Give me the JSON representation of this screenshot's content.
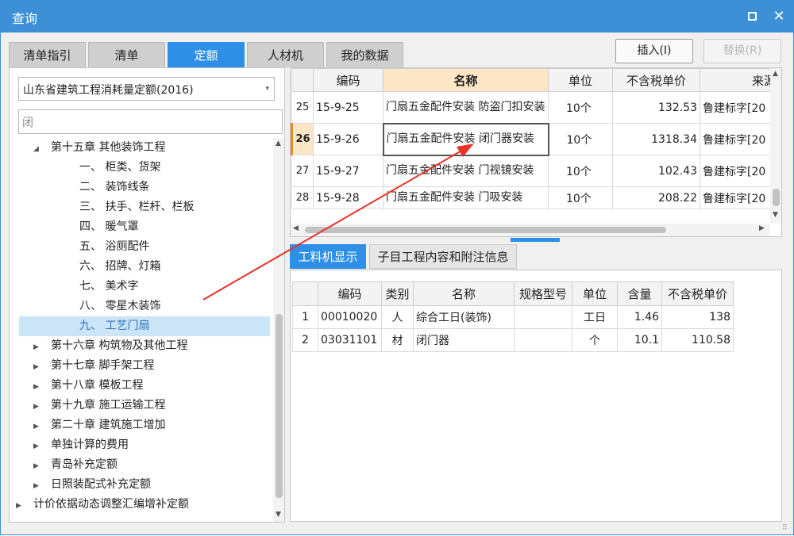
{
  "window": {
    "title": "查询",
    "maximize_glyph": "",
    "close_glyph": "✕"
  },
  "tabs": [
    "清单指引",
    "清单",
    "定额",
    "人材机",
    "我的数据"
  ],
  "active_tab": "定额",
  "buttons": {
    "insert": "插入(I)",
    "replace": "替换(R)"
  },
  "left": {
    "dropdown_value": "山东省建筑工程消耗量定额(2016)",
    "search_value": "闭",
    "tree": [
      {
        "label": "第十五章 其他装饰工程",
        "level": 1,
        "expanded": true
      },
      {
        "label": "一、 柜类、货架",
        "level": 2
      },
      {
        "label": "二、 装饰线条",
        "level": 2
      },
      {
        "label": "三、 扶手、栏杆、栏板",
        "level": 2
      },
      {
        "label": "四、 暖气罩",
        "level": 2
      },
      {
        "label": "五、 浴厕配件",
        "level": 2
      },
      {
        "label": "六、 招牌、灯箱",
        "level": 2
      },
      {
        "label": "七、 美术字",
        "level": 2
      },
      {
        "label": "八、 零星木装饰",
        "level": 2
      },
      {
        "label": "九、 工艺门扇",
        "level": 2,
        "selected": true
      },
      {
        "label": "第十六章 构筑物及其他工程",
        "level": 1
      },
      {
        "label": "第十七章 脚手架工程",
        "level": 1
      },
      {
        "label": "第十八章 模板工程",
        "level": 1
      },
      {
        "label": "第十九章 施工运输工程",
        "level": 1
      },
      {
        "label": "第二十章 建筑施工增加",
        "level": 1
      },
      {
        "label": "单独计算的费用",
        "level": 1
      },
      {
        "label": "青岛补充定额",
        "level": 1
      },
      {
        "label": "日照装配式补充定额",
        "level": 1
      },
      {
        "label": "计价依据动态调整汇编增补定额",
        "level": 0
      }
    ]
  },
  "quota_table": {
    "headers": [
      "编码",
      "名称",
      "单位",
      "不含税单价",
      "来源"
    ],
    "rows": [
      {
        "rn": "25",
        "code": "15-9-25",
        "name": "门扇五金配件安装 防盗门扣安装",
        "unit": "10个",
        "price": "132.53",
        "source": "鲁建标字[20"
      },
      {
        "rn": "26",
        "code": "15-9-26",
        "name": "门扇五金配件安装 闭门器安装",
        "unit": "10个",
        "price": "1318.34",
        "source": "鲁建标字[20",
        "current": true
      },
      {
        "rn": "27",
        "code": "15-9-27",
        "name": "门扇五金配件安装 门视镜安装",
        "unit": "10个",
        "price": "102.43",
        "source": "鲁建标字[20"
      },
      {
        "rn": "28",
        "code": "15-9-28",
        "name": "门扇五金配件安装 门吸安装",
        "unit": "10个",
        "price": "208.22",
        "source": "鲁建标字[20"
      }
    ]
  },
  "lower_tabs": [
    "工料机显示",
    "子目工程内容和附注信息"
  ],
  "resource_table": {
    "headers": [
      "编码",
      "类别",
      "名称",
      "规格型号",
      "单位",
      "含量",
      "不含税单价"
    ],
    "rows": [
      {
        "rn": "1",
        "code": "00010020",
        "type": "人",
        "name": "综合工日(装饰)",
        "spec": "",
        "unit": "工日",
        "qty": "1.46",
        "price": "138"
      },
      {
        "rn": "2",
        "code": "03031101",
        "type": "材",
        "name": "闭门器",
        "spec": "",
        "unit": "个",
        "qty": "10.1",
        "price": "110.58"
      }
    ]
  },
  "colors": {
    "titlebar": "#3d8fd6",
    "active_tab": "#2e8fe6",
    "highlight_header": "#fde6c6",
    "arrow": "#e8322a"
  }
}
